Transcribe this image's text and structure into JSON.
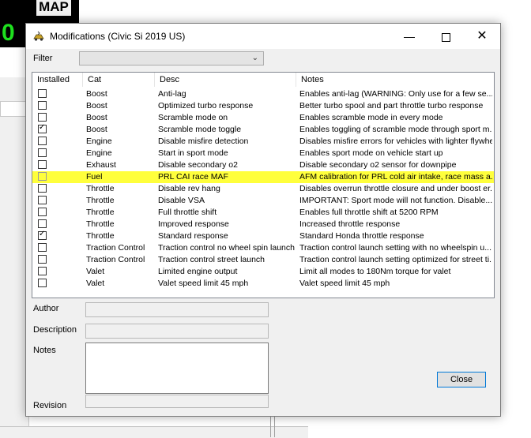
{
  "background": {
    "map_label": "MAP",
    "green_digit": "0"
  },
  "dialog": {
    "title": "Modifications (Civic Si 2019 US)",
    "window_controls": {
      "minimize": "—",
      "close": "✕"
    }
  },
  "filter": {
    "label": "Filter",
    "selected": ""
  },
  "list": {
    "headers": {
      "installed": "Installed",
      "cat": "Cat",
      "desc": "Desc",
      "notes": "Notes"
    },
    "rows": [
      {
        "installed": false,
        "cat": "Boost",
        "desc": "Anti-lag",
        "notes": "Enables anti-lag (WARNING: Only use for a few se...",
        "highlighted": false
      },
      {
        "installed": false,
        "cat": "Boost",
        "desc": "Optimized turbo response",
        "notes": "Better turbo spool and part throttle turbo response",
        "highlighted": false
      },
      {
        "installed": false,
        "cat": "Boost",
        "desc": "Scramble mode on",
        "notes": "Enables scramble mode in every mode",
        "highlighted": false
      },
      {
        "installed": true,
        "cat": "Boost",
        "desc": "Scramble mode toggle",
        "notes": "Enables toggling of scramble mode through sport m...",
        "highlighted": false
      },
      {
        "installed": false,
        "cat": "Engine",
        "desc": "Disable misfire detection",
        "notes": "Disables misfire errors for vehicles with lighter flywhe...",
        "highlighted": false
      },
      {
        "installed": false,
        "cat": "Engine",
        "desc": "Start in sport mode",
        "notes": "Enables sport mode on vehicle start up",
        "highlighted": false
      },
      {
        "installed": false,
        "cat": "Exhaust",
        "desc": "Disable secondary o2",
        "notes": "Disable secondary o2 sensor for downpipe",
        "highlighted": false
      },
      {
        "installed": false,
        "cat": "Fuel",
        "desc": "PRL CAI race MAF",
        "notes": "AFM calibration for PRL cold air intake, race mass a...",
        "highlighted": true
      },
      {
        "installed": false,
        "cat": "Throttle",
        "desc": "Disable rev hang",
        "notes": "Disables overrun throttle closure and under boost er...",
        "highlighted": false
      },
      {
        "installed": false,
        "cat": "Throttle",
        "desc": "Disable VSA",
        "notes": "IMPORTANT: Sport mode will not function. Disable...",
        "highlighted": false
      },
      {
        "installed": false,
        "cat": "Throttle",
        "desc": "Full throttle shift",
        "notes": "Enables full throttle shift at 5200 RPM",
        "highlighted": false
      },
      {
        "installed": false,
        "cat": "Throttle",
        "desc": "Improved response",
        "notes": "Increased throttle response",
        "highlighted": false
      },
      {
        "installed": true,
        "cat": "Throttle",
        "desc": "Standard response",
        "notes": "Standard Honda throttle response",
        "highlighted": false
      },
      {
        "installed": false,
        "cat": "Traction Control",
        "desc": "Traction control no wheel spin launch",
        "notes": "Traction control launch setting with no wheelspin u...",
        "highlighted": false
      },
      {
        "installed": false,
        "cat": "Traction Control",
        "desc": "Traction control street launch",
        "notes": "Traction control launch setting optimized for street ti...",
        "highlighted": false
      },
      {
        "installed": false,
        "cat": "Valet",
        "desc": "Limited engine output",
        "notes": "Limit all modes to 180Nm torque for valet",
        "highlighted": false
      },
      {
        "installed": false,
        "cat": "Valet",
        "desc": "Valet speed limit 45 mph",
        "notes": "Valet speed limit 45 mph",
        "highlighted": false
      }
    ]
  },
  "fields": {
    "author_label": "Author",
    "description_label": "Description",
    "notes_label": "Notes",
    "revision_label": "Revision"
  },
  "buttons": {
    "close_label": "Close"
  },
  "colors": {
    "highlight": "#ffff3c",
    "accent_border": "#0078d7"
  }
}
